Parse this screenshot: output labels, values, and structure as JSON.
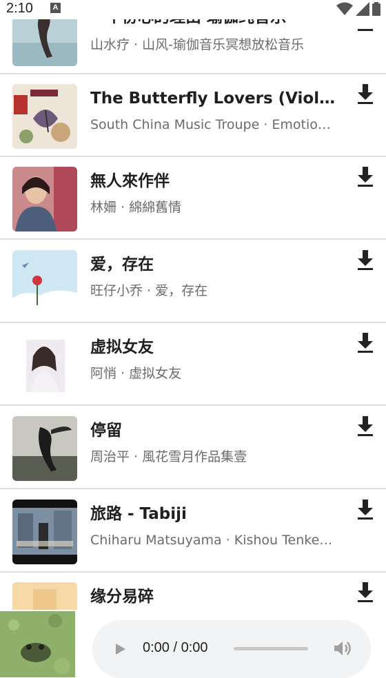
{
  "status_bar": {
    "time": "2:10",
    "badge": "A",
    "icons": [
      "wifi-icon",
      "signal-icon",
      "battery-icon"
    ]
  },
  "tracks": [
    {
      "title": "一个份心的理由 瑜伽纯音乐",
      "subtitle": "山水疗 · 山风-瑜伽音乐冥想放松音乐",
      "cover": "dancer-cover"
    },
    {
      "title": "The Butterfly Lovers (Violin Concerto)",
      "subtitle": "South China Music Troupe · Emotional",
      "cover": "butterfly-cover"
    },
    {
      "title": "無人來作伴",
      "subtitle": "林姍 · 綿綿舊情",
      "cover": "portrait-cover"
    },
    {
      "title": "爱，存在",
      "subtitle": "旺仔小乔 · 爱，存在",
      "cover": "rose-cover"
    },
    {
      "title": "虚拟女友",
      "subtitle": "阿悄 · 虚拟女友",
      "cover": "girl-cover"
    },
    {
      "title": "停留",
      "subtitle": "周治平 · 風花雪月作品集壹",
      "cover": "bw-cover"
    },
    {
      "title": "旅路 - Tabiji",
      "subtitle": "Chiharu Matsuyama · Kishou Tenketsu",
      "cover": "street-cover"
    },
    {
      "title": "缘分易碎",
      "subtitle": "",
      "cover": "peach-cover"
    }
  ],
  "player": {
    "time_display": "0:00 / 0:00",
    "progress": 0,
    "thumb": "frog-thumb"
  },
  "icons": {
    "download": "download-icon",
    "play": "play-icon",
    "volume": "volume-icon"
  },
  "colors": {
    "title": "#1f1f1f",
    "subtitle": "#6b6b6b",
    "divider": "#e0e0e0",
    "player_bg": "#f1f3f4"
  }
}
